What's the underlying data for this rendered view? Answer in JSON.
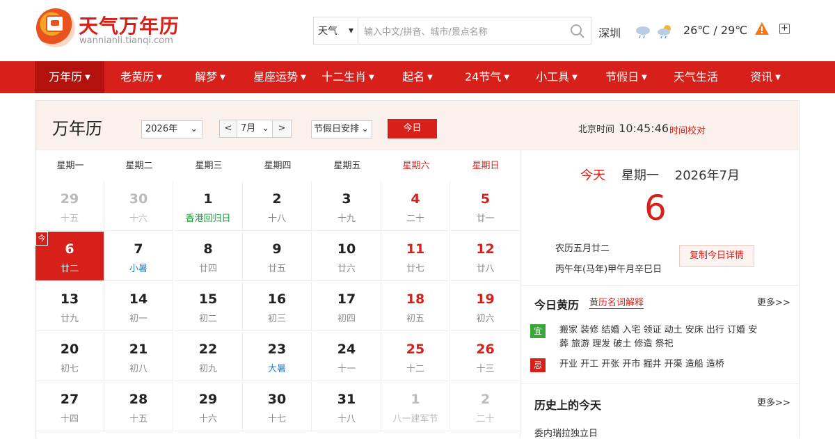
{
  "brand": {
    "name": "天气万年历",
    "domain": "wannianli.tianqi.com"
  },
  "search": {
    "type": "天气",
    "placeholder": "输入中文/拼音、城市/景点名称"
  },
  "weather": {
    "city": "深圳",
    "temp": "26℃ / 29℃"
  },
  "nav": [
    "万年历",
    "老黄历",
    "解梦",
    "星座运势",
    "十二生肖",
    "起名",
    "24节气",
    "小工具",
    "节假日",
    "天气生活",
    "资讯"
  ],
  "calendar": {
    "title": "万年历",
    "year_select": "2026年",
    "month_select": "7月",
    "holiday_select": "节假日安排",
    "today_button": "今日",
    "beijing_label": "北京时间",
    "beijing_time": "10:45:46",
    "time_link": "时间校对",
    "weekdays": [
      "星期一",
      "星期二",
      "星期三",
      "星期四",
      "星期五",
      "星期六",
      "星期日"
    ],
    "today_tag": "今",
    "rows": [
      [
        {
          "d": "29",
          "l": "十五",
          "s": "muted"
        },
        {
          "d": "30",
          "l": "十六",
          "s": "muted"
        },
        {
          "d": "1",
          "l": "香港回归日",
          "s": "fest"
        },
        {
          "d": "2",
          "l": "十八"
        },
        {
          "d": "3",
          "l": "十九"
        },
        {
          "d": "4",
          "l": "二十",
          "s": "red"
        },
        {
          "d": "5",
          "l": "廿一",
          "s": "red"
        }
      ],
      [
        {
          "d": "6",
          "l": "廿二",
          "s": "today"
        },
        {
          "d": "7",
          "l": "小暑",
          "s": "term"
        },
        {
          "d": "8",
          "l": "廿四"
        },
        {
          "d": "9",
          "l": "廿五"
        },
        {
          "d": "10",
          "l": "廿六"
        },
        {
          "d": "11",
          "l": "廿七",
          "s": "red"
        },
        {
          "d": "12",
          "l": "廿八",
          "s": "red"
        }
      ],
      [
        {
          "d": "13",
          "l": "廿九"
        },
        {
          "d": "14",
          "l": "初一"
        },
        {
          "d": "15",
          "l": "初二"
        },
        {
          "d": "16",
          "l": "初三"
        },
        {
          "d": "17",
          "l": "初四"
        },
        {
          "d": "18",
          "l": "初五",
          "s": "red"
        },
        {
          "d": "19",
          "l": "初六",
          "s": "red"
        }
      ],
      [
        {
          "d": "20",
          "l": "初七"
        },
        {
          "d": "21",
          "l": "初八"
        },
        {
          "d": "22",
          "l": "初九"
        },
        {
          "d": "23",
          "l": "大暑",
          "s": "term"
        },
        {
          "d": "24",
          "l": "十一"
        },
        {
          "d": "25",
          "l": "十二",
          "s": "red"
        },
        {
          "d": "26",
          "l": "十三",
          "s": "red"
        }
      ],
      [
        {
          "d": "27",
          "l": "十四"
        },
        {
          "d": "28",
          "l": "十五"
        },
        {
          "d": "29",
          "l": "十六"
        },
        {
          "d": "30",
          "l": "十七"
        },
        {
          "d": "31",
          "l": "十八"
        },
        {
          "d": "1",
          "l": "八一建军节",
          "s": "muted"
        },
        {
          "d": "2",
          "l": "二十",
          "s": "muted"
        }
      ]
    ]
  },
  "today": {
    "label": "今天",
    "weekday": "星期一",
    "ym": "2026年7月",
    "day": "6",
    "lunar": "农历五月廿二",
    "ganzhi": "丙午年(马年)甲午月辛巳日",
    "copy_button": "复制今日详情"
  },
  "almanac": {
    "title": "今日黄历",
    "link": "黄历名词解释",
    "more": "更多>>",
    "yi_label": "宜",
    "yi": "搬家 装修 结婚 入宅 领证 动土 安床 出行 订婚 安葬 旅游 理发 破土 修造 祭祀",
    "ji_label": "忌",
    "ji": "开业 开工 开张 开市 掘井 开渠 造船 造桥"
  },
  "history": {
    "title": "历史上的今天",
    "more": "更多>>",
    "first": "委内瑞拉独立日"
  },
  "colors": {
    "brand_red": "#d8201a",
    "nav_active": "#b2110d",
    "yi_green": "#3aa63a",
    "ji_red": "#d8201a"
  }
}
